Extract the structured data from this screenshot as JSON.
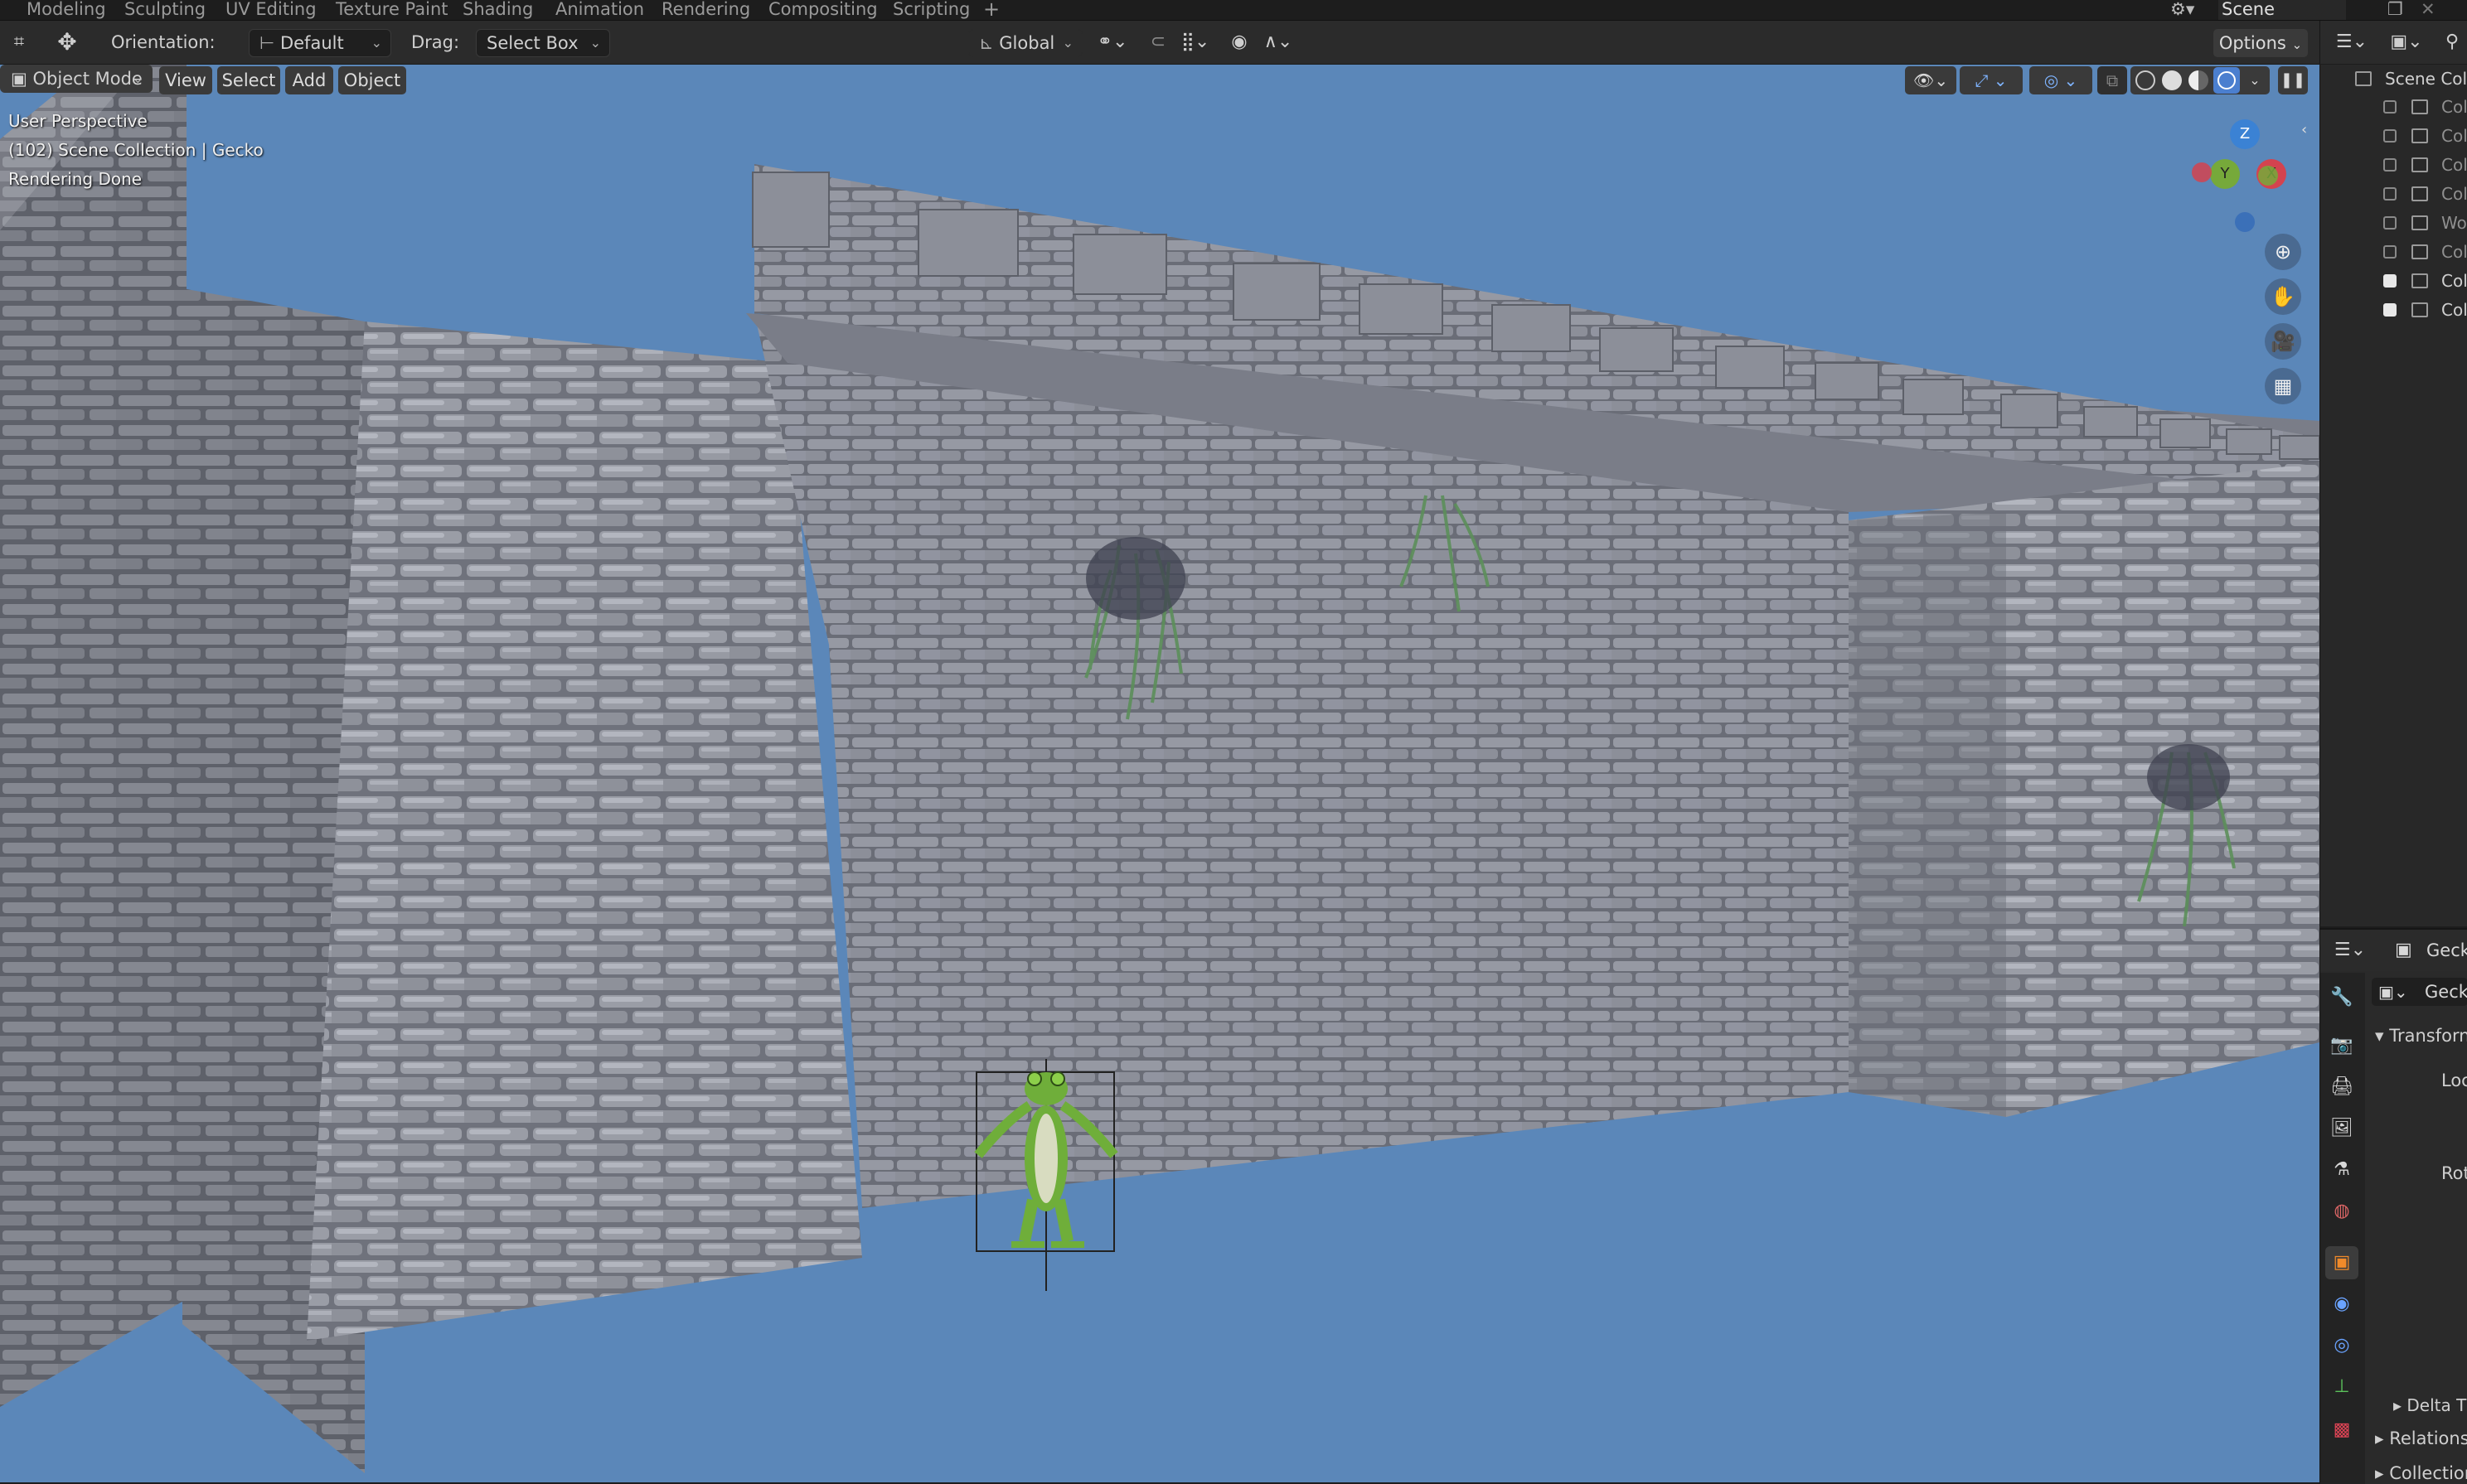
{
  "workspace_tabs": [
    "Modeling",
    "Sculpting",
    "UV Editing",
    "Texture Paint",
    "Shading",
    "Animation",
    "Rendering",
    "Compositing",
    "Scripting"
  ],
  "add_tab_symbol": "+",
  "scene_field": "Scene",
  "header": {
    "orientation_label": "Orientation:",
    "orientation_value": "Default",
    "drag_label": "Drag:",
    "drag_value": "Select Box",
    "transform_space": "Global",
    "options_label": "Options"
  },
  "viewport_header": {
    "mode": "Object Mode",
    "menus": [
      "View",
      "Select",
      "Add",
      "Object"
    ]
  },
  "viewport_overlay": {
    "line1": "User Perspective",
    "line2": "(102) Scene Collection | Gecko",
    "line3": "Rendering Done"
  },
  "gizmo": {
    "z": "Z",
    "y": "Y",
    "x": "X"
  },
  "outliner": {
    "root": "Scene Colle",
    "items": [
      {
        "name": "Col",
        "checked": false
      },
      {
        "name": "Col",
        "checked": false
      },
      {
        "name": "Col",
        "checked": false
      },
      {
        "name": "Col",
        "checked": false
      },
      {
        "name": "Wo",
        "checked": false
      },
      {
        "name": "Col",
        "checked": false
      },
      {
        "name": "Col",
        "checked": true
      },
      {
        "name": "Col",
        "checked": true
      }
    ]
  },
  "properties": {
    "object_name": "Geck",
    "data_name": "Geck",
    "transform": "Transforn",
    "location": "Loc",
    "rotation": "Rot",
    "delta": "Delta T",
    "relations": "Relations",
    "collections": "Collection"
  },
  "colors": {
    "viewport_bg": "#5b87b9",
    "accent_blue": "#4b7fcf",
    "gizmo_x": "#d4434f",
    "gizmo_y": "#76a93a",
    "gizmo_z": "#3b82d4"
  }
}
